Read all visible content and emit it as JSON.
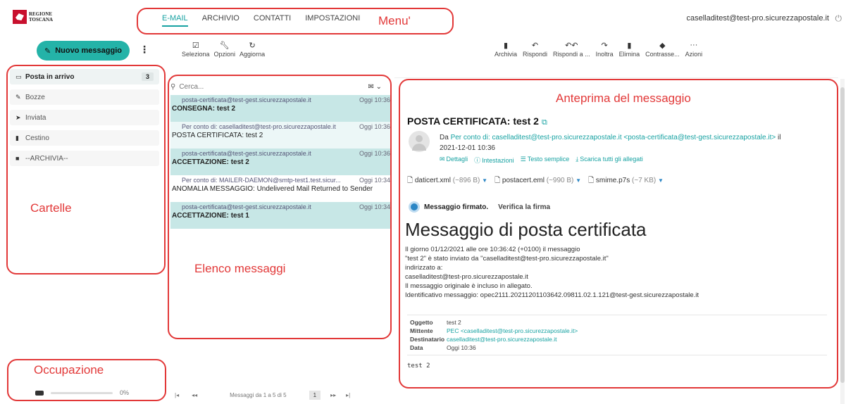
{
  "brand": {
    "line1": "REGIONE",
    "line2": "TOSCANA"
  },
  "menu": {
    "items": [
      "E-MAIL",
      "ARCHIVIO",
      "CONTATTI",
      "IMPOSTAZIONI"
    ],
    "active": "E-MAIL"
  },
  "user": {
    "email": "caselladitest@test-pro.sicurezzapostale.it"
  },
  "annotations": {
    "menu": "Menu'",
    "folders": "Cartelle",
    "list": "Elenco messaggi",
    "preview": "Anteprima del messaggio",
    "quota": "Occupazione"
  },
  "sidebar": {
    "new_label": "Nuovo messaggio",
    "folders": [
      {
        "label": "Posta in arrivo",
        "count": "3",
        "icon": "inbox-icon"
      },
      {
        "label": "Bozze",
        "icon": "pencil-icon"
      },
      {
        "label": "Inviata",
        "icon": "send-icon"
      },
      {
        "label": "Cestino",
        "icon": "trash-icon"
      },
      {
        "label": "--ARCHIVIA--",
        "icon": "folder-icon"
      }
    ],
    "quota": {
      "percent_label": "0%",
      "fraction": 0.0
    }
  },
  "list_toolbar": {
    "select": "Seleziona",
    "options": "Opzioni",
    "refresh": "Aggiorna"
  },
  "search": {
    "placeholder": "Cerca..."
  },
  "messages": [
    {
      "from": "posta-certificata@test-gest.sicurezzapostale.it",
      "date": "Oggi 10:36",
      "subject": "CONSEGNA: test 2",
      "state": "unread"
    },
    {
      "from": "Per conto di: caselladitest@test-pro.sicurezzapostale.it",
      "date": "Oggi 10:36",
      "subject": "POSTA CERTIFICATA: test 2",
      "state": "read"
    },
    {
      "from": "posta-certificata@test-gest.sicurezzapostale.it",
      "date": "Oggi 10:36",
      "subject": "ACCETTAZIONE: test 2",
      "state": "unread"
    },
    {
      "from": "Per conto di: MAILER-DAEMON@smtp-test1.test.sicur...",
      "date": "Oggi 10:34",
      "subject": "ANOMALIA MESSAGGIO: Undelivered Mail Returned to Sender",
      "state": "plain"
    },
    {
      "from": "posta-certificata@test-gest.sicurezzapostale.it",
      "date": "Oggi 10:34",
      "subject": "ACCETTAZIONE: test 1",
      "state": "unread"
    }
  ],
  "pager": {
    "first": "|◂",
    "prev": "◂◂",
    "label": "Messaggi da 1 a 5 di 5",
    "page": "1",
    "next": "▸▸",
    "last": "▸|"
  },
  "view_toolbar": [
    "Archivia",
    "Rispondi",
    "Rispondi a ...",
    "Inoltra",
    "Elimina",
    "Contrasse...",
    "Azioni"
  ],
  "preview": {
    "subject": "POSTA CERTIFICATA: test 2",
    "from_prefix": "Da",
    "sender": "Per conto di: caselladitest@test-pro.sicurezzapostale.it <posta-certificata@test-gest.sicurezzapostale.it>",
    "from_suffix": "il",
    "date": "2021-12-01 10:36",
    "links": [
      "Dettagli",
      "Intestazioni",
      "Testo semplice",
      "Scarica tutti gli allegati"
    ],
    "attachments": [
      {
        "name": "daticert.xml",
        "size": "(~896 B)"
      },
      {
        "name": "postacert.eml",
        "size": "(~990 B)"
      },
      {
        "name": "smime.p7s",
        "size": "(~7 KB)"
      }
    ],
    "signed": "Messaggio firmato.",
    "verify": "Verifica la firma",
    "title": "Messaggio di posta certificata",
    "body_lines": [
      "Il giorno 01/12/2021 alle ore 10:36:42 (+0100) il messaggio",
      "\"test 2\" è stato inviato da \"caselladitest@test-pro.sicurezzapostale.it\"",
      "indirizzato a:",
      "caselladitest@test-pro.sicurezzapostale.it",
      "Il messaggio originale è incluso in allegato.",
      "Identificativo messaggio: opec2111.20211201103642.09811.02.1.121@test-gest.sicurezzapostale.it"
    ],
    "meta": [
      {
        "k": "Oggetto",
        "v": "test 2",
        "link": false
      },
      {
        "k": "Mittente",
        "v": "PEC <caselladitest@test-pro.sicurezzapostale.it>",
        "link": true
      },
      {
        "k": "Destinatario",
        "v": "caselladitest@test-pro.sicurezzapostale.it",
        "link": true
      },
      {
        "k": "Data",
        "v": "Oggi 10:36",
        "link": false
      }
    ],
    "plain_body": "test 2"
  }
}
